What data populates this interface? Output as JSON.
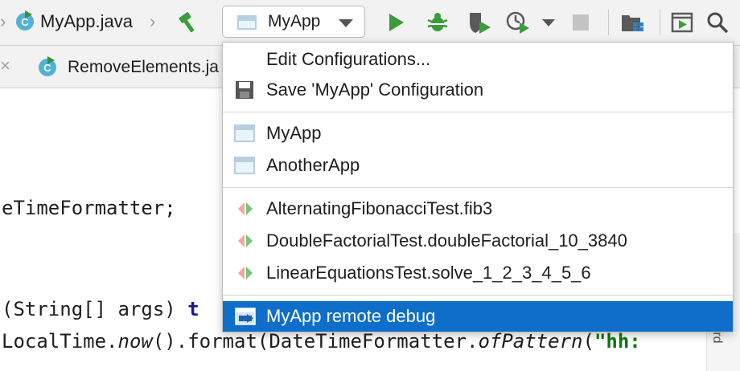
{
  "toolbar": {
    "file_tab_label": "MyApp.java",
    "class_badge": "C",
    "run_config_label": "MyApp"
  },
  "tabs": {
    "close_glyph": "×",
    "active_file": "RemoveElements.ja",
    "class_badge": "C"
  },
  "editor": {
    "line1": "eTimeFormatter;",
    "line2_prefix": "(String[] args) ",
    "line2_kw": "t",
    "line3_a": "LocalTime.",
    "line3_now": "now",
    "line3_b": "().format(DateTimeFormatter.",
    "line3_pattern": "ofPattern",
    "line3_c": "(",
    "line3_str": "\"hh:",
    "gutter_text": "tard"
  },
  "dropdown": {
    "edit_configurations": "Edit Configurations...",
    "save_configuration": "Save 'MyApp' Configuration",
    "configurations": [
      {
        "label": "MyApp",
        "icon": "application-config-icon"
      },
      {
        "label": "AnotherApp",
        "icon": "application-config-icon"
      }
    ],
    "tests": [
      {
        "label": "AlternatingFibonacciTest.fib3",
        "icon": "test-config-icon"
      },
      {
        "label": "DoubleFactorialTest.doubleFactorial_10_3840",
        "icon": "test-config-icon"
      },
      {
        "label": "LinearEquationsTest.solve_1_2_3_4_5_6",
        "icon": "test-config-icon"
      }
    ],
    "remote_debug": {
      "label": "MyApp remote debug",
      "icon": "remote-debug-icon",
      "selected": true
    }
  },
  "colors": {
    "selection": "#0f6ec9",
    "run_green": "#3c9c3c",
    "test_red": "#f0a8a0",
    "test_green": "#7cc47c",
    "keyword": "#1a1a8c",
    "string": "#0b7a0b"
  }
}
